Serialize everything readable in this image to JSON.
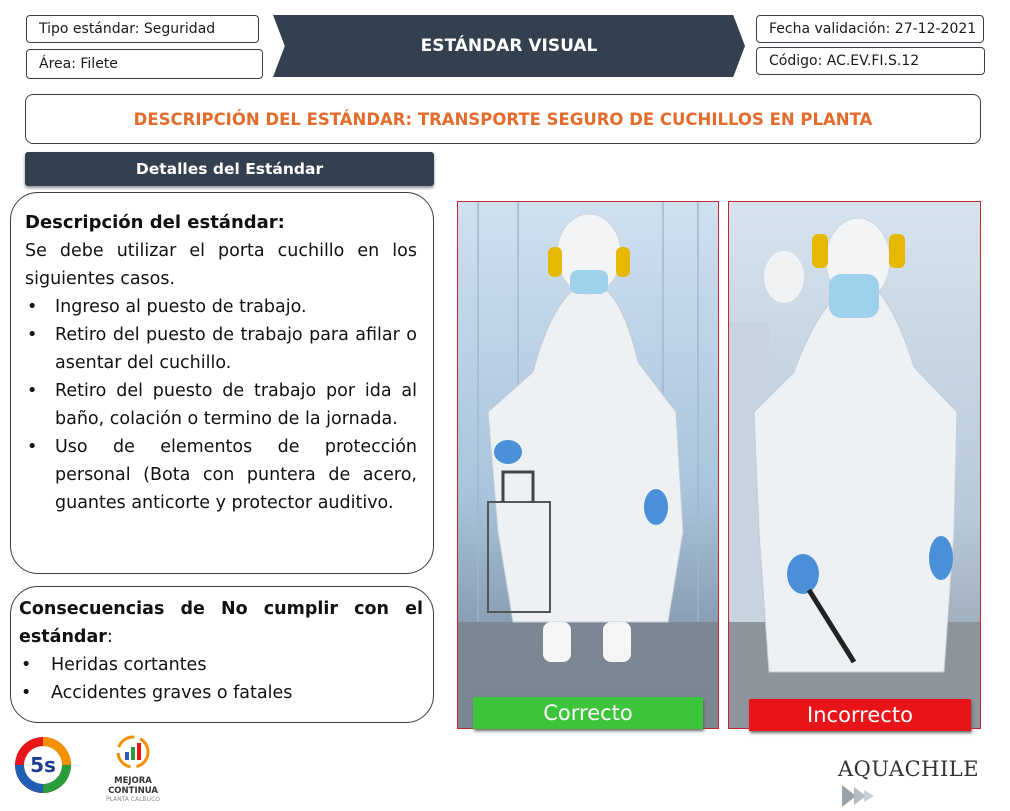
{
  "header": {
    "tipo": "Tipo estándar: Seguridad",
    "area": "Área: Filete",
    "banner": "ESTÁNDAR VISUAL",
    "fecha": "Fecha validación: 27-12-2021",
    "codigo": "Código: AC.EV.FI.S.12"
  },
  "title": "DESCRIPCIÓN DEL ESTÁNDAR: TRANSPORTE SEGURO DE CUCHILLOS EN PLANTA",
  "details_header": "Detalles del Estándar",
  "descripcion": {
    "heading": "Descripción del estándar:",
    "intro": "Se debe utilizar el porta cuchillo en los siguientes casos.",
    "items": [
      "Ingreso al puesto de trabajo.",
      "Retiro del puesto de trabajo para afilar o asentar del cuchillo.",
      "Retiro del puesto de trabajo por ida al baño, colación o termino de la jornada.",
      "Uso de elementos de protección personal (Bota con puntera de acero, guantes anticorte y protector auditivo."
    ]
  },
  "consecuencias": {
    "heading": "Consecuencias de No cumplir con el estándar",
    "colon": ":",
    "items": [
      "Heridas cortantes",
      "Accidentes graves o fatales"
    ]
  },
  "photos": {
    "correct_label": "Correcto",
    "incorrect_label": "Incorrecto"
  },
  "logos": {
    "five_s": "5s",
    "mejora_line1": "MEJORA CONTINUA",
    "mejora_line2": "PLANTA CALBUCO",
    "aquachile": "AQUACHILE"
  },
  "colors": {
    "navy": "#33404f",
    "orange_title": "#e36c2c",
    "correct_green": "#3cc43b",
    "incorrect_red": "#e8141a"
  }
}
